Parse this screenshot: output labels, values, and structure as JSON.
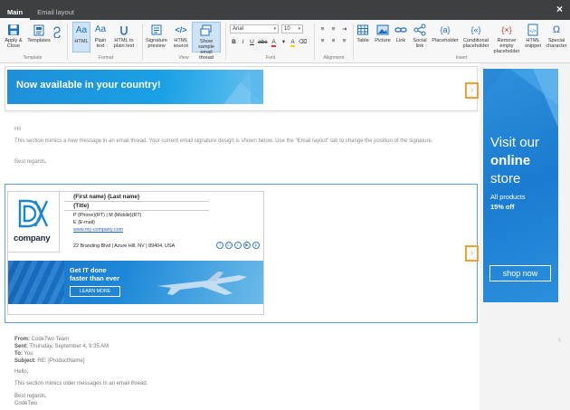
{
  "titlebar": {
    "tabs": [
      "Main",
      "Email layout"
    ],
    "close": "×"
  },
  "ribbon": {
    "groups": {
      "template": "Template",
      "format": "Format",
      "view": "View",
      "font": "Font",
      "alignment": "Alignment",
      "insert": "Insert"
    },
    "buttons": {
      "apply_close": "Apply & Close",
      "templates": "Templates",
      "html": "HTML",
      "plain_text": "Plain text",
      "html_to_plain": "HTML to plain text",
      "signature_preview": "Signature preview",
      "html_source": "HTML source",
      "show_sample": "Show sample email thread",
      "table": "Table",
      "picture": "Picture",
      "link": "Link",
      "social_link": "Social link",
      "placeholder": "Placeholder",
      "conditional_placeholder": "Conditional placeholder",
      "remove_empty_placeholder": "Remove empty placeholder",
      "html_snippet": "HTML snippet",
      "special_character": "Special character"
    },
    "font_name": "Arial",
    "font_size": "10"
  },
  "banner_top": {
    "text": "Now available in your country!"
  },
  "message": {
    "greeting": "Hi!",
    "body": "This section mimics a new message in an email thread. Your current email signature design is shown below. Use the \"Email layout\" tab to change the position of the signature.",
    "closing": "Best regards,"
  },
  "signature": {
    "company": "company",
    "name": "{First name} {Last name}",
    "title": "{Title}",
    "phones": "P {Phone}(RT) | M {Mobile}(RT)",
    "email": "E {E-mail}",
    "website": "www.my-company.com",
    "address": "22 Branding Blvd | Azure Hill, NV | 89404, USA",
    "social": [
      "f",
      "in",
      "t",
      "▶",
      "p"
    ],
    "banner": {
      "headline1": "Get IT done",
      "headline2": "faster than ever",
      "button": "LEARN MORE"
    }
  },
  "side_ad": {
    "line1": "Visit our",
    "line2": "online",
    "line3": "store",
    "sub1": "All products",
    "sub2": "15% off",
    "button": "shop now"
  },
  "old_message": {
    "from_label": "From:",
    "from": "CodeTwo Team",
    "sent_label": "Sent:",
    "sent": "Thursday, September 4, 9:35 AM",
    "to_label": "To:",
    "to": "You",
    "subject_label": "Subject:",
    "subject": "RE: {ProductName}",
    "hello": "Hello,",
    "body": "This section mimics older messages in an email thread.",
    "closing": "Best regards,",
    "signoff": "CodeTwo"
  },
  "colors": {
    "titlebar": "#3c4043",
    "accent_blue": "#1a8fe0",
    "nav_arrow_border": "#f0a030"
  }
}
